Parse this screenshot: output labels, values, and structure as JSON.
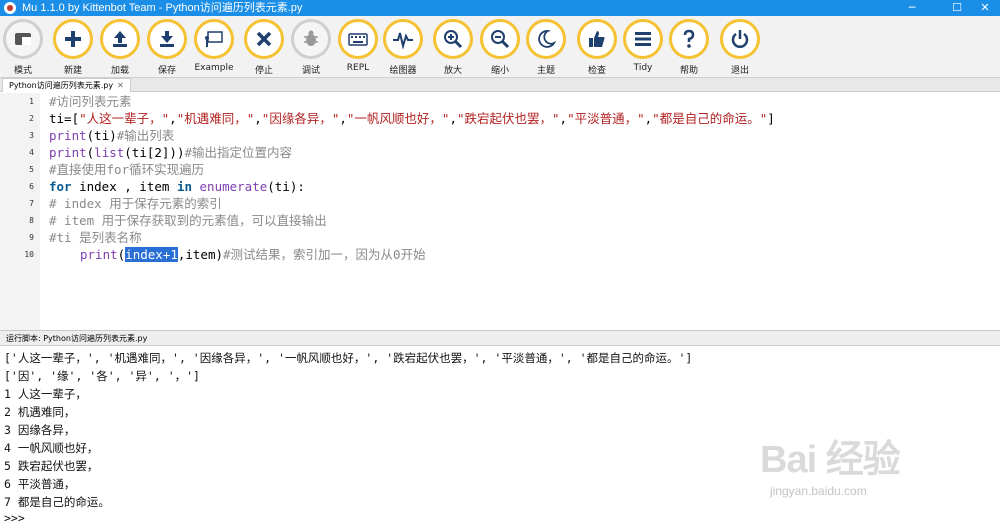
{
  "window": {
    "title": "Mu 1.1.0 by Kittenbot Team - Python访问遍历列表元素.py",
    "minimize": "─",
    "maximize": "☐",
    "close": "✕"
  },
  "toolbar": {
    "items": [
      {
        "label": "模式",
        "icon": "mode-icon"
      },
      {
        "label": "新建",
        "icon": "plus-icon"
      },
      {
        "label": "加载",
        "icon": "upload-icon"
      },
      {
        "label": "保存",
        "icon": "download-icon"
      },
      {
        "label": "Example",
        "icon": "presentation-icon"
      },
      {
        "label": "停止",
        "icon": "close-icon"
      },
      {
        "label": "调试",
        "icon": "bug-icon"
      },
      {
        "label": "REPL",
        "icon": "keyboard-icon"
      },
      {
        "label": "绘图器",
        "icon": "pulse-icon"
      },
      {
        "label": "放大",
        "icon": "zoom-in-icon"
      },
      {
        "label": "缩小",
        "icon": "zoom-out-icon"
      },
      {
        "label": "主题",
        "icon": "moon-icon"
      },
      {
        "label": "检查",
        "icon": "thumbs-up-icon"
      },
      {
        "label": "Tidy",
        "icon": "menu-icon"
      },
      {
        "label": "帮助",
        "icon": "help-icon"
      },
      {
        "label": "退出",
        "icon": "power-icon"
      }
    ]
  },
  "tab": {
    "label": "Python访问遍历列表元素.py",
    "close": "✕"
  },
  "editor": {
    "line_numbers": [
      "1",
      "2",
      "3",
      "4",
      "5",
      "6",
      "7",
      "8",
      "9",
      "10"
    ],
    "line1": "#访问列表元素",
    "line2_a": "ti=[",
    "line2_b": "\"人这一辈子，\"",
    "line2_c": ",",
    "line2_d": "\"机遇难同，\"",
    "line2_e": ",",
    "line2_f": "\"因缘各异，\"",
    "line2_g": ",",
    "line2_h": "\"一帆风顺也好，\"",
    "line2_i": ",",
    "line2_j": "\"跌宕起伏也罢，\"",
    "line2_k": ",",
    "line2_l": "\"平淡普通，\"",
    "line2_m": ",",
    "line2_n": "\"都是自己的命运。\"",
    "line2_o": "]",
    "line3_a": "print",
    "line3_b": "(ti)",
    "line3_c": "#输出列表",
    "line4_a": "print",
    "line4_b": "(",
    "line4_c": "list",
    "line4_d": "(ti[2]))",
    "line4_e": "#输出指定位置内容",
    "line5": "#直接使用for循环实现遍历",
    "line6_a": "for",
    "line6_b": " index , item ",
    "line6_c": "in",
    "line6_d": " ",
    "line6_e": "enumerate",
    "line6_f": "(ti):",
    "line7": "# index 用于保存元素的索引",
    "line8": "# item 用于保存获取到的元素值，可以直接输出",
    "line9": "#ti 是列表名称",
    "line10_a": "print",
    "line10_b": "(",
    "line10_c": "index+1",
    "line10_d": ",item)",
    "line10_e": "#测试结果，索引加一，因为从0开始"
  },
  "run": {
    "label": "运行脚本: Python访问遍历列表元素.py"
  },
  "output": {
    "lines": [
      "['人这一辈子，', '机遇难同，', '因缘各异，', '一帆风顺也好，', '跌宕起伏也罢，', '平淡普通，', '都是自己的命运。']",
      "['因', '缘', '各', '异', '，']",
      "1 人这一辈子，",
      "2 机遇难同，",
      "3 因缘各异，",
      "4 一帆风顺也好，",
      "5 跌宕起伏也罢，",
      "6 平淡普通，",
      "7 都是自己的命运。",
      ">>>"
    ]
  },
  "watermark": {
    "logo": "Bai 经验",
    "url": "jingyan.baidu.com"
  }
}
